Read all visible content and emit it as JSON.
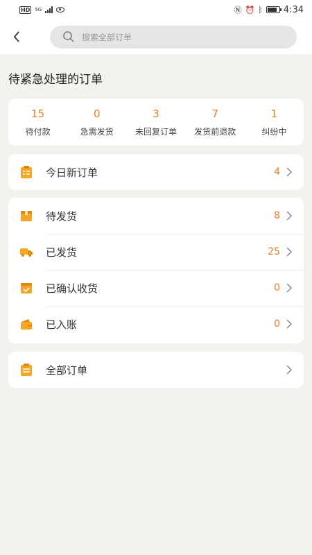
{
  "status_bar": {
    "hd": "HD",
    "network": "5G",
    "time": "4:34"
  },
  "header": {
    "search_placeholder": "搜索全部订单"
  },
  "section_title": "待紧急处理的订单",
  "stats": [
    {
      "value": "15",
      "label": "待付款"
    },
    {
      "value": "0",
      "label": "急需发货"
    },
    {
      "value": "3",
      "label": "未回复订单"
    },
    {
      "value": "7",
      "label": "发货前退款"
    },
    {
      "value": "1",
      "label": "纠纷中"
    }
  ],
  "today": {
    "label": "今日新订单",
    "count": "4"
  },
  "shipping": [
    {
      "label": "待发货",
      "count": "8"
    },
    {
      "label": "已发货",
      "count": "25"
    },
    {
      "label": "已确认收货",
      "count": "0"
    },
    {
      "label": "已入账",
      "count": "0"
    }
  ],
  "all_orders": {
    "label": "全部订单"
  },
  "colors": {
    "accent": "#e67e22",
    "icon": "#f5a623",
    "background": "#f3f2ef"
  }
}
